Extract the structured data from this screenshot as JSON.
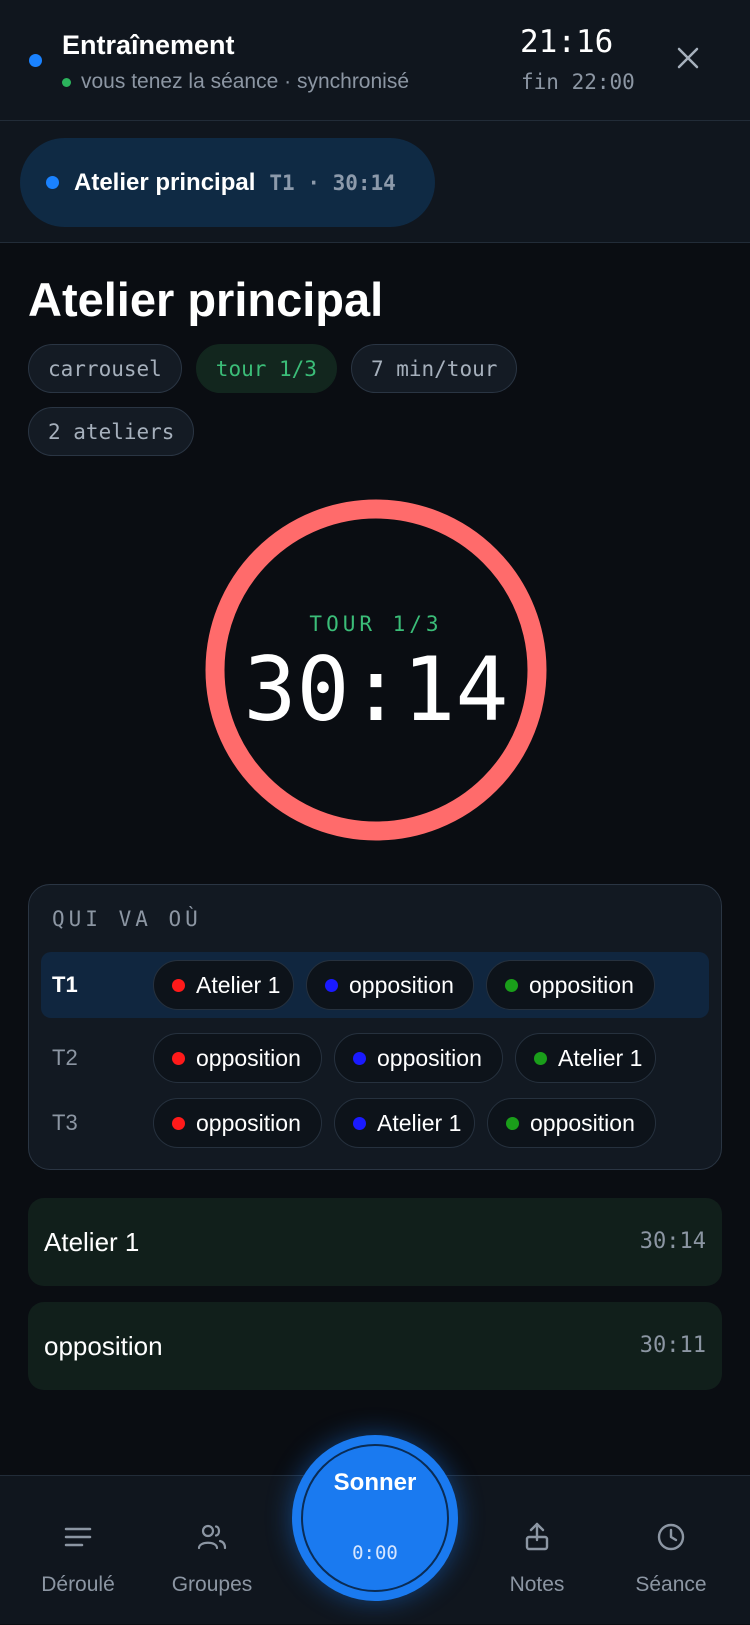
{
  "header": {
    "title": "Entraînement",
    "status": "vous tenez la séance · synchronisé",
    "clock": "21:16",
    "end": "fin 22:00",
    "close_icon": "close-icon"
  },
  "active_block": {
    "name": "Atelier principal",
    "meta": "T1 · 30:14"
  },
  "block": {
    "title": "Atelier principal",
    "tags": [
      "carrousel",
      "tour 1/3",
      "7 min/tour",
      "2 ateliers"
    ]
  },
  "timer": {
    "round_label": "TOUR 1/3",
    "time": "30:14",
    "ring_color": "#ff6b6b"
  },
  "rotation": {
    "title": "QUI VA OÙ",
    "group_colors": [
      "#ff1a1a",
      "#1a1aff",
      "#1a9e1a"
    ],
    "rows": [
      {
        "label": "T1",
        "chips": [
          "Atelier 1",
          "opposition",
          "opposition"
        ]
      },
      {
        "label": "T2",
        "chips": [
          "opposition",
          "opposition",
          "Atelier 1"
        ]
      },
      {
        "label": "T3",
        "chips": [
          "opposition",
          "Atelier 1",
          "opposition"
        ]
      }
    ]
  },
  "stations": [
    {
      "name": "Atelier 1",
      "time": "30:14"
    },
    {
      "name": "opposition",
      "time": "30:11"
    }
  ],
  "nav": {
    "items": [
      {
        "label": "Déroulé",
        "icon": "list-icon"
      },
      {
        "label": "Groupes",
        "icon": "users-icon"
      },
      {
        "label": "Notes",
        "icon": "share-icon"
      },
      {
        "label": "Séance",
        "icon": "clock-icon"
      }
    ],
    "ring_button": {
      "label": "Sonner",
      "time": "0:00"
    }
  },
  "colors": {
    "accent": "#1a82ff",
    "green": "#3bbd78",
    "background": "#0a0d12"
  }
}
